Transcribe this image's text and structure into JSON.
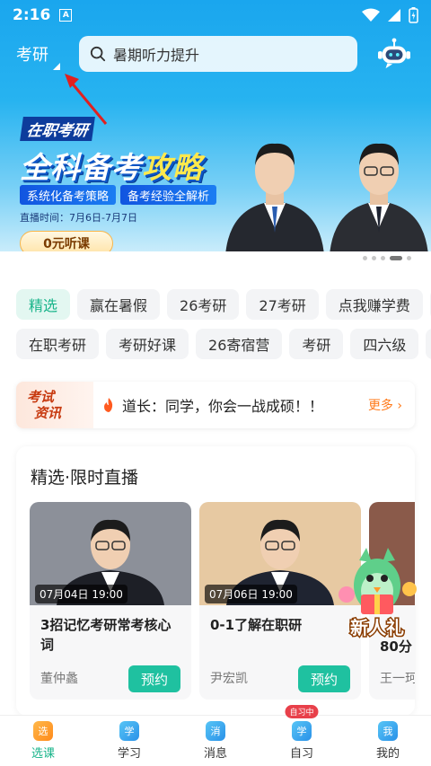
{
  "status_bar": {
    "time": "2:16",
    "notif_letter": "A"
  },
  "header": {
    "city": "考研",
    "search_placeholder": "暑期听力提升"
  },
  "banner": {
    "badge": "在职考研",
    "title_main": "全科备考",
    "title_hl": "攻略",
    "tag1": "系统化备考策略",
    "tag2": "备考经验全解析",
    "date": "直播时间：7月6日-7月7日",
    "button": "0元听课"
  },
  "tags": {
    "row1": [
      "精选",
      "赢在暑假",
      "26考研",
      "27考研",
      "点我赚学费"
    ],
    "row2": [
      "在职考研",
      "考研好课",
      "26寄宿营",
      "考研",
      "四六级"
    ]
  },
  "news": {
    "logo_top": "考试",
    "logo_bottom": "资讯",
    "text": "道长：同学，你会一战成硕！！",
    "more": "更多 ›"
  },
  "live": {
    "title": "精选·限时直播",
    "cards": [
      {
        "date": "07月04日 19:00",
        "title": "3招记忆考研常考核心词",
        "teacher": "董仲蠡",
        "button": "预约"
      },
      {
        "date": "07月06日 19:00",
        "title": "0-1了解在职研",
        "teacher": "尹宏凯",
        "button": "预约"
      },
      {
        "title": "80分",
        "teacher": "王一珂"
      }
    ]
  },
  "promo": {
    "label": "新人礼"
  },
  "bottom_nav": {
    "items": [
      {
        "label": "选课",
        "icon": "选"
      },
      {
        "label": "学习",
        "icon": "学"
      },
      {
        "label": "消息",
        "icon": "消"
      },
      {
        "label": "自习",
        "icon": "学",
        "badge": "自习中"
      },
      {
        "label": "我的",
        "icon": "我"
      }
    ]
  }
}
